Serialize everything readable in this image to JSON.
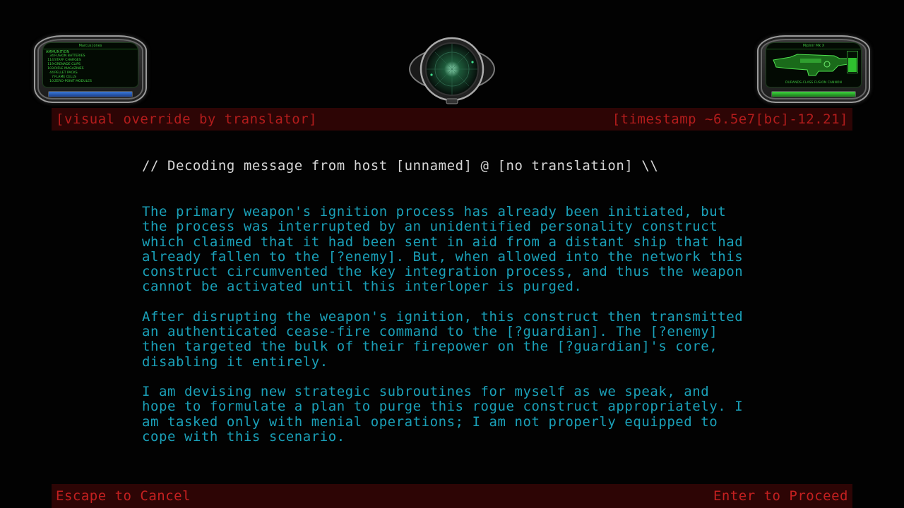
{
  "inventory": {
    "player_name": "Marcus Jones",
    "header": "AMMUNITION",
    "ammo": [
      {
        "count": "34",
        "label": "FUSION BATTERIES"
      },
      {
        "count": "114",
        "label": "STAFF CHARGES"
      },
      {
        "count": "119",
        "label": "GRENADE CLIPS"
      },
      {
        "count": "103",
        "label": "RIFLE MAGAZINES"
      },
      {
        "count": "44",
        "label": "PELLET PACKS"
      },
      {
        "count": "7",
        "label": "FLAME CELLS"
      },
      {
        "count": "10",
        "label": "ZERO-POINT MODULES"
      }
    ],
    "health_fraction": 1.0,
    "colors": {
      "text": "#44d444",
      "bar": "#3a78d8"
    }
  },
  "weapon": {
    "title": "Mjolnir Mk X",
    "name": "DURANDS-CLASS FUSION CANNON",
    "energy_fraction": 0.75,
    "charge_fraction": 1.0,
    "colors": {
      "text": "#3fbf3f",
      "bar": "#3fd43f"
    }
  },
  "radar": {
    "icon": "radar-icon"
  },
  "header": {
    "left": "[visual override by translator]",
    "right": "[timestamp ~6.5e7[bc]-12.21]"
  },
  "message": {
    "heading": "// Decoding message from host [unnamed] @ [no translation] \\\\",
    "paragraphs": [
      "The primary weapon's ignition process has already been initiated, but\nthe process was interrupted by an unidentified personality construct\nwhich claimed that it had been sent in aid from a distant ship that had\nalready fallen to the [?enemy]. But, when allowed into the network this\nconstruct circumvented the key integration process, and thus the weapon\ncannot be activated until this interloper is purged.",
      "After disrupting the weapon's ignition, this construct then transmitted\nan authenticated cease-fire command to the [?guardian]. The [?enemy]\nthen targeted the bulk of their firepower on the [?guardian]'s core,\ndisabling it entirely.",
      "I am devising new strategic subroutines for myself as we speak, and\nhope to formulate a plan to purge this rogue construct appropriately. I\nam tasked only with menial operations; I am not properly equipped to\ncope with this scenario."
    ],
    "colors": {
      "heading": "#d6d6d6",
      "body": "#1aa0b8"
    }
  },
  "footer": {
    "cancel": "Escape to Cancel",
    "proceed": "Enter to Proceed"
  },
  "colors": {
    "bar_bg": "#2d0505",
    "bar_text": "#b81d1d"
  }
}
